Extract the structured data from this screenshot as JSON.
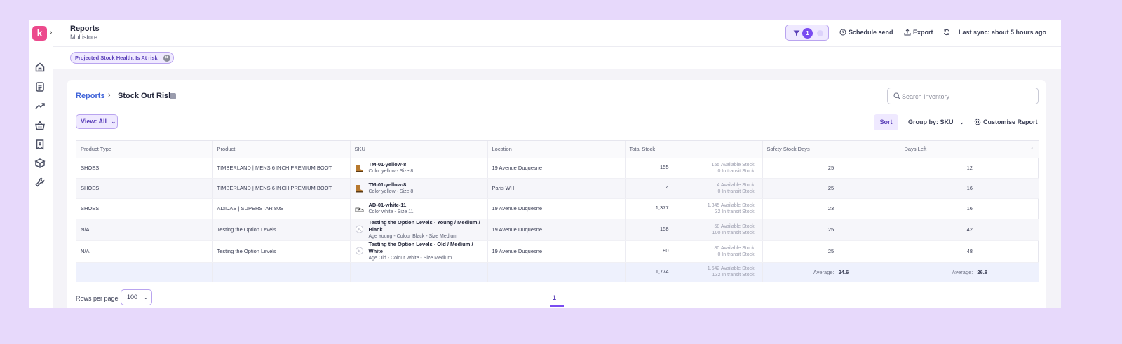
{
  "app": {
    "logo_letter": "k",
    "title": "Reports",
    "subtitle": "Multistore"
  },
  "sidebar": {
    "items": [
      {
        "icon": "home-icon"
      },
      {
        "icon": "reports-icon"
      },
      {
        "icon": "trending-icon"
      },
      {
        "icon": "basket-icon"
      },
      {
        "icon": "receipt-icon"
      },
      {
        "icon": "boxes-icon"
      },
      {
        "icon": "tools-icon"
      }
    ]
  },
  "header": {
    "filter_count": "1",
    "schedule_label": "Schedule send",
    "export_label": "Export",
    "last_sync": "Last sync: about 5 hours ago"
  },
  "filters": {
    "chip_label": "Projected Stock Health:  Is  At risk",
    "chip_close": "×"
  },
  "breadcrumb": {
    "link": "Reports",
    "separator": "›",
    "current": "Stock Out Risk"
  },
  "search": {
    "placeholder": "Search Inventory"
  },
  "toolbar": {
    "view_label": "View: All",
    "sort_label": "Sort",
    "group_by_label": "Group by: SKU",
    "customise_label": "Customise Report"
  },
  "table": {
    "columns": [
      "Product Type",
      "Product",
      "SKU",
      "Location",
      "Total Stock",
      "Safety Stock Days",
      "Days Left"
    ],
    "rows": [
      {
        "type": "SHOES",
        "product": "TIMBERLAND | MENS 6 INCH PREMIUM BOOT",
        "sku": "TM-01-yellow-8",
        "variant": "Color yellow - Size 8",
        "thumb": "boot",
        "location": "19 Avenue Duquesne",
        "total": "155",
        "available": "155 Available Stock",
        "transit": "0 In transit Stock",
        "safety": "25",
        "days_left": "12"
      },
      {
        "type": "SHOES",
        "product": "TIMBERLAND | MENS 6 INCH PREMIUM BOOT",
        "sku": "TM-01-yellow-8",
        "variant": "Color yellow - Size 8",
        "thumb": "boot",
        "location": "Paris WH",
        "total": "4",
        "available": "4 Available Stock",
        "transit": "0 In transit Stock",
        "safety": "25",
        "days_left": "16"
      },
      {
        "type": "SHOES",
        "product": "ADIDAS | SUPERSTAR 80S",
        "sku": "AD-01-white-11",
        "variant": "Color white - Size 11",
        "thumb": "sneaker",
        "location": "19 Avenue Duquesne",
        "total": "1,377",
        "available": "1,345 Available Stock",
        "transit": "32 In transit Stock",
        "safety": "23",
        "days_left": "16"
      },
      {
        "type": "N/A",
        "product": "Testing the Option Levels",
        "sku": "Testing the Option Levels - Young / Medium / Black",
        "variant": "Age Young - Colour Black - Size Medium",
        "thumb": "placeholder",
        "location": "19 Avenue Duquesne",
        "total": "158",
        "available": "58 Available Stock",
        "transit": "100 In transit Stock",
        "safety": "25",
        "days_left": "42"
      },
      {
        "type": "N/A",
        "product": "Testing the Option Levels",
        "sku": "Testing the Option Levels - Old / Medium / White",
        "variant": "Age Old - Colour White - Size Medium",
        "thumb": "placeholder",
        "location": "19 Avenue Duquesne",
        "total": "80",
        "available": "80 Available Stock",
        "transit": "0 In transit Stock",
        "safety": "25",
        "days_left": "48"
      }
    ],
    "totals": {
      "total": "1,774",
      "available": "1,642 Available Stock",
      "transit": "132 In transit Stock",
      "safety_label": "Average:",
      "safety_avg": "24.6",
      "days_label": "Average:",
      "days_avg": "26.8"
    }
  },
  "pagination": {
    "rows_label": "Rows per page",
    "rows_value": "100",
    "current_page": "1"
  },
  "colors": {
    "accent": "#7a4cf1",
    "logo": "#ec4a8c",
    "background": "#e7d9fb",
    "link": "#3f63d8"
  }
}
